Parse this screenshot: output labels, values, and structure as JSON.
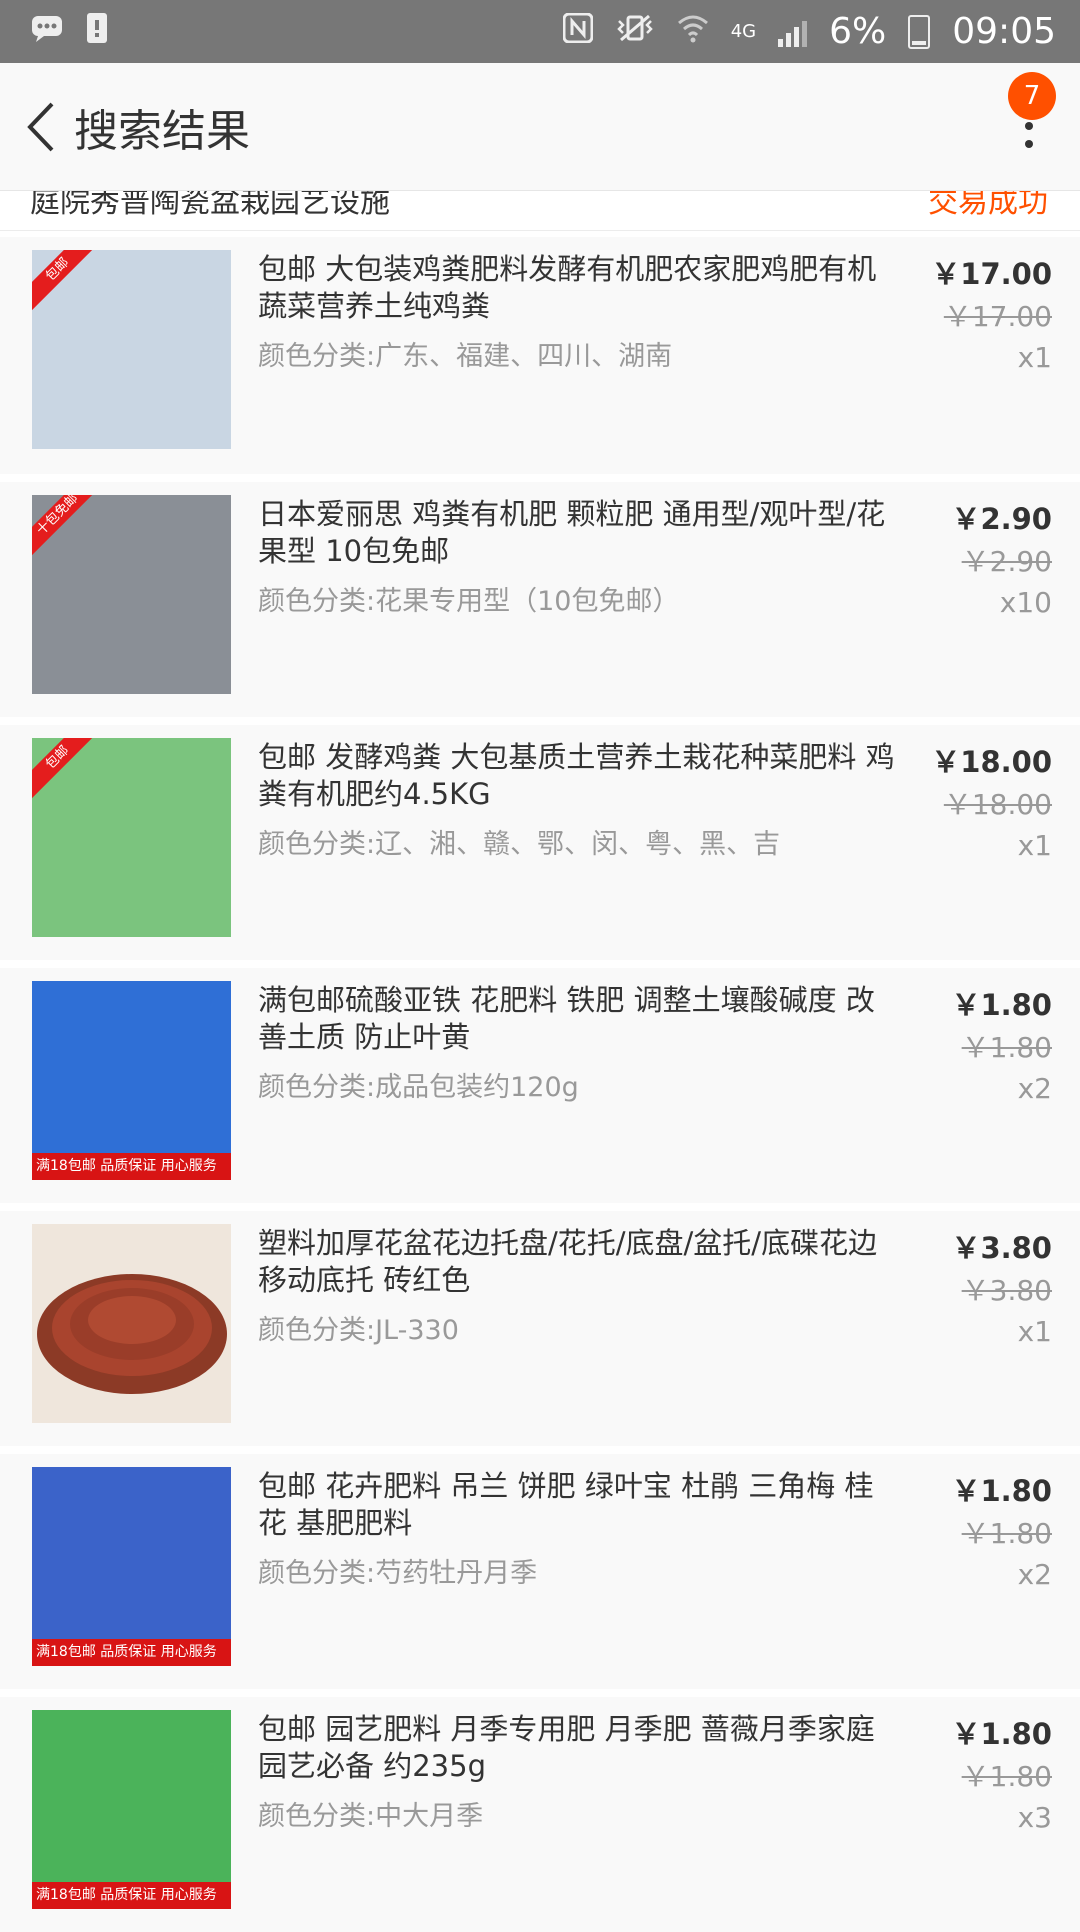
{
  "status_bar": {
    "network": "4G",
    "battery": "6%",
    "time": "09:05"
  },
  "header": {
    "title": "搜索结果",
    "badge_count": "7"
  },
  "peek_row": {
    "text": "庭院秀普陶瓷盆栽园艺设施",
    "status": "交易成功"
  },
  "items": [
    {
      "tag": "包邮",
      "strip": "",
      "thumb_color": "#c9d6e3",
      "name": "包邮 大包装鸡粪肥料发酵有机肥农家肥鸡肥有机蔬菜营养土纯鸡粪",
      "variant": "颜色分类:广东、福建、四川、湖南",
      "price": "￥17.00",
      "original_price": "￥17.00",
      "qty": "x1"
    },
    {
      "tag": "十包免邮",
      "strip": "",
      "thumb_color": "#8a8f96",
      "name": "日本爱丽思 鸡粪有机肥 颗粒肥 通用型/观叶型/花果型 10包免邮",
      "variant": "颜色分类:花果专用型（10包免邮）",
      "price": "￥2.90",
      "original_price": "￥2.90",
      "qty": "x10"
    },
    {
      "tag": "包邮",
      "strip": "",
      "thumb_color": "#7bc47e",
      "name": "包邮 发酵鸡粪 大包基质土营养土栽花种菜肥料 鸡粪有机肥约4.5KG",
      "variant": "颜色分类:辽、湘、赣、鄂、闵、粤、黑、吉",
      "price": "￥18.00",
      "original_price": "￥18.00",
      "qty": "x1"
    },
    {
      "tag": "",
      "strip": "满18包邮 品质保证 用心服务",
      "thumb_color": "#2f6fd6",
      "name": "满包邮硫酸亚铁 花肥料 铁肥 调整土壤酸碱度 改善土质 防止叶黄",
      "variant": "颜色分类:成品包装约120g",
      "price": "￥1.80",
      "original_price": "￥1.80",
      "qty": "x2"
    },
    {
      "tag": "",
      "strip": "",
      "thumb_color": "#a9442e",
      "name": "塑料加厚花盆花边托盘/花托/底盘/盆托/底碟花边移动底托 砖红色",
      "variant": "颜色分类:JL-330",
      "price": "￥3.80",
      "original_price": "￥3.80",
      "qty": "x1"
    },
    {
      "tag": "",
      "strip": "满18包邮 品质保证 用心服务",
      "thumb_color": "#3b63c9",
      "name": "包邮  花卉肥料 吊兰 饼肥 绿叶宝 杜鹃 三角梅 桂花 基肥肥料",
      "variant": "颜色分类:芍药牡丹月季",
      "price": "￥1.80",
      "original_price": "￥1.80",
      "qty": "x2"
    },
    {
      "tag": "",
      "strip": "满18包邮 品质保证 用心服务",
      "thumb_color": "#4bb35a",
      "name": "包邮 园艺肥料 月季专用肥 月季肥 蔷薇月季家庭园艺必备 约235g",
      "variant": "颜色分类:中大月季",
      "price": "￥1.80",
      "original_price": "￥1.80",
      "qty": "x3"
    }
  ]
}
